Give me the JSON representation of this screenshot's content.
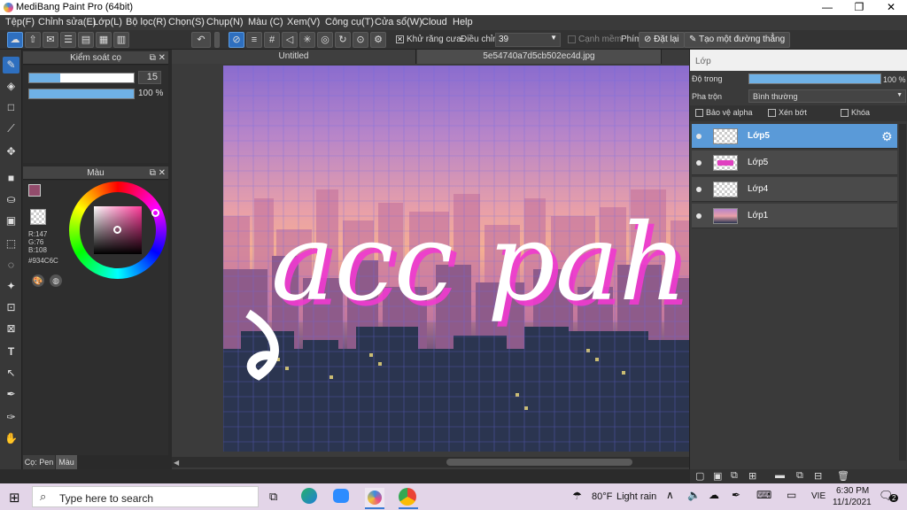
{
  "window": {
    "title": "MediBang Paint Pro (64bit)",
    "controls": [
      "—",
      "❐",
      "✕"
    ]
  },
  "menu": [
    "Tệp(F)",
    "Chỉnh sửa(E)",
    "Lớp(L)",
    "Bộ lọc(R)",
    "Chọn(S)",
    "Chụp(N)",
    "Màu (C)",
    "Xem(V)",
    "Công cụ(T)",
    "Cửa sổ(W)",
    "Cloud",
    "Help"
  ],
  "toolbar": {
    "antialias_label": "Khử răng cưa",
    "antialias_checked": "✕",
    "adjust_label": "Điều chỉnh",
    "adjust_value": "39",
    "edge_label": "Cạnh mềm",
    "key_label": "Phím",
    "reset_label": "Đặt lại",
    "line_label": "Tạo một đường thẳng"
  },
  "brush_panel": {
    "title": "Kiểm soát cọ",
    "size_value": "15",
    "opacity_value": "100 %",
    "size_fraction": 0.3,
    "opacity_fraction": 1.0
  },
  "color_panel": {
    "title": "Màu",
    "r": "R:147",
    "g": "G:76",
    "b": "B:108",
    "hex": "#934C6C",
    "current_color": "#934C6C"
  },
  "bottom_tabs": [
    "Cọ: Pen",
    "Màu"
  ],
  "doc_tabs": [
    "Untitled",
    "5e54740a7d5cb502ec4d.jpg"
  ],
  "canvas": {
    "lettering": "acc pah"
  },
  "layer_panel": {
    "title": "Lớp",
    "opacity_label": "Độ trong",
    "opacity_value": "100 %",
    "blend_label": "Pha trộn",
    "blend_value": "Bình thường",
    "protect_alpha": "Bảo vệ alpha",
    "clip": "Xén bớt",
    "lock": "Khóa",
    "layers": [
      {
        "name": "Lớp5",
        "selected": true
      },
      {
        "name": "Lớp5",
        "selected": false
      },
      {
        "name": "Lớp4",
        "selected": false
      },
      {
        "name": "Lớp1",
        "selected": false
      }
    ]
  },
  "taskbar": {
    "search_placeholder": "Type here to search",
    "weather_temp": "80°F",
    "weather_text": "Light rain",
    "lang": "VIE",
    "time": "6:30 PM",
    "date": "11/1/2021",
    "notif_count": "2"
  }
}
